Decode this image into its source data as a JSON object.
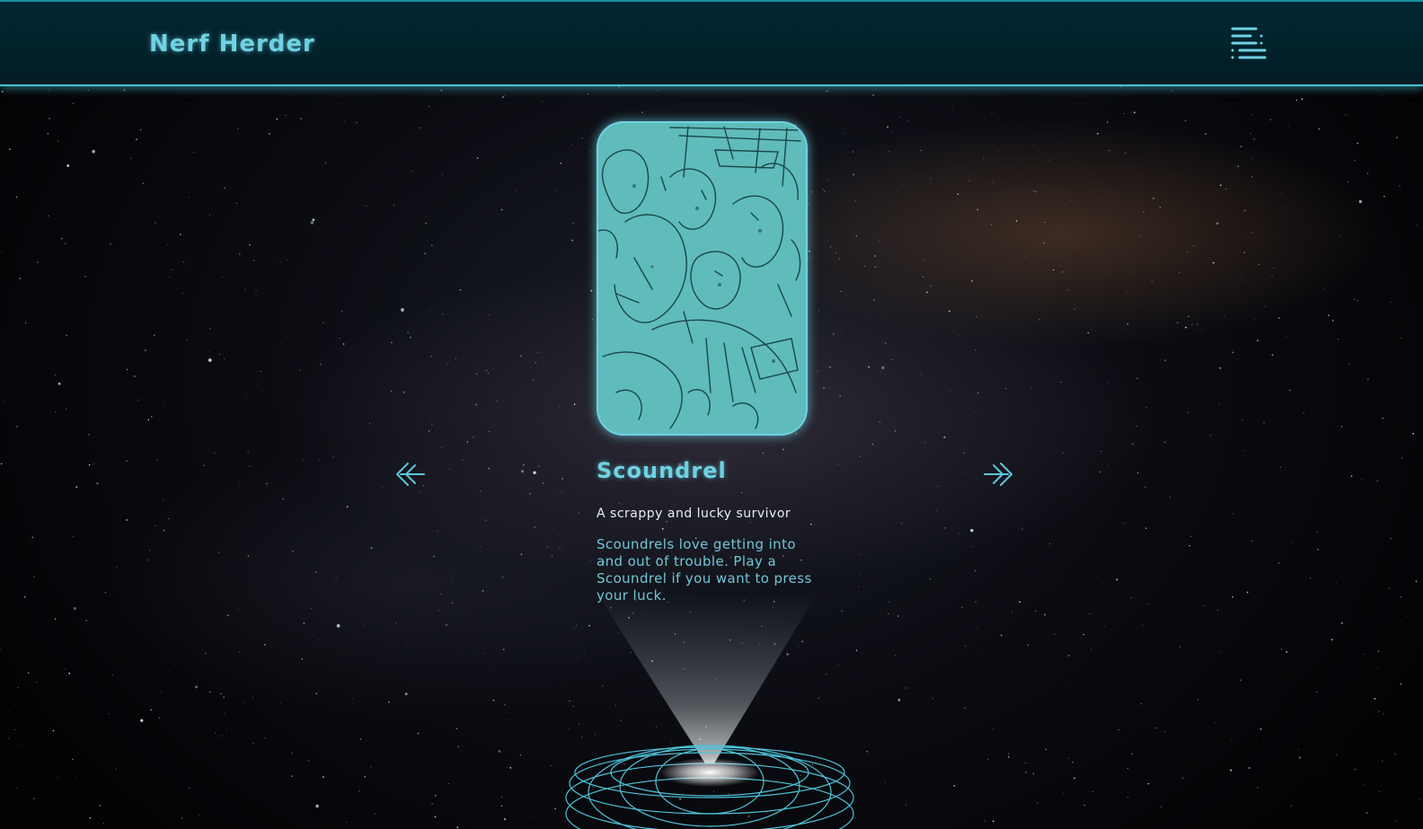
{
  "header": {
    "brand": "Nerf Herder",
    "menu_icon": "menu-list-icon"
  },
  "carousel": {
    "prev_icon": "arrow-left-icon",
    "next_icon": "arrow-right-icon",
    "card": {
      "image_icon": "scoundrel-illustration",
      "title": "Scoundrel",
      "subtitle": "A scrappy and lucky survivor",
      "description": "Scoundrels love getting into and out of trouble. Play a Scoundrel if you want to press your luck."
    }
  },
  "colors": {
    "accent": "#6fd2e3",
    "header_bg": "#022630",
    "card_fill": "#5fbcbb",
    "subtitle": "#e8eef0"
  }
}
